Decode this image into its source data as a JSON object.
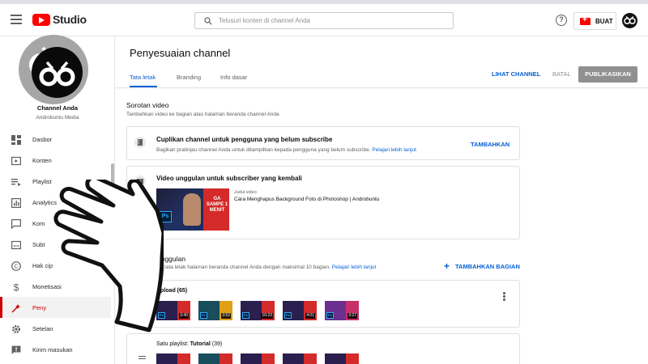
{
  "app": {
    "logo_text": "Studio",
    "search_placeholder": "Telusuri konten di channel Anda",
    "help_icon": "question-circle-icon",
    "create_label": "BUAT",
    "accent": "#065fd4",
    "brand": "#ff0000"
  },
  "channel": {
    "name": "Channel Anda",
    "subtitle": "Androbuntu Media"
  },
  "sidebar": {
    "items": [
      {
        "label": "Dasbor",
        "icon": "dashboard-icon"
      },
      {
        "label": "Konten",
        "icon": "content-icon"
      },
      {
        "label": "Playlist",
        "icon": "playlist-icon"
      },
      {
        "label": "Analytics",
        "icon": "analytics-icon"
      },
      {
        "label": "Kom",
        "icon": "comments-icon"
      },
      {
        "label": "Subt",
        "icon": "subtitles-icon"
      },
      {
        "label": "Hak cip",
        "icon": "copyright-icon"
      },
      {
        "label": "Monetisasi",
        "icon": "dollar-icon"
      },
      {
        "label": "Peny",
        "icon": "customization-icon"
      },
      {
        "label": "Setelan",
        "icon": "gear-icon"
      },
      {
        "label": "Kirim masukan",
        "icon": "feedback-icon"
      }
    ]
  },
  "header": {
    "title": "Penyesuaian channel",
    "tabs": [
      {
        "label": "Tata letak"
      },
      {
        "label": "Branding"
      },
      {
        "label": "Info dasar"
      }
    ],
    "view_channel": "LIHAT CHANNEL",
    "cancel": "BATAL",
    "publish": "PUBLIKASIKAN"
  },
  "spotlight": {
    "title": "Sorotan video",
    "description": "Tambahkan video ke bagian atas halaman beranda channel Anda",
    "trailer_card": {
      "title": "Cuplikan channel untuk pengguna yang belum subscribe",
      "description": "Bagikan pratinjau channel Anda untuk ditampilkan kepada pengguna yang belum subscribe.",
      "learn_more": "Pelajari lebih lanjut",
      "action": "TAMBAHKAN"
    },
    "featured_card": {
      "title": "Video unggulan untuk subscriber yang kembali",
      "video_label": "Judul video",
      "video_title": "Cara Menghapus Background Foto di Photoshop | Androbuntu",
      "thumb_text": "GA SAMPE 1 MENIT",
      "thumb_badge": "Ps"
    }
  },
  "featured_sections": {
    "title_fragment": "unggulan",
    "description": "an tata letak halaman beranda channel Anda dengan maksimal 10 bagian.",
    "learn_more": "Pelajari lebih lanjut",
    "add_section": "TAMBAHKAN BAGIAN",
    "uploads": {
      "label": "Upload (65)",
      "durations": [
        "3:40",
        "3:52",
        "10:23",
        "4:01",
        "3:27"
      ]
    },
    "playlist": {
      "prefix": "Satu playlist: ",
      "name": "Tutorial",
      "count": " (39)"
    }
  }
}
